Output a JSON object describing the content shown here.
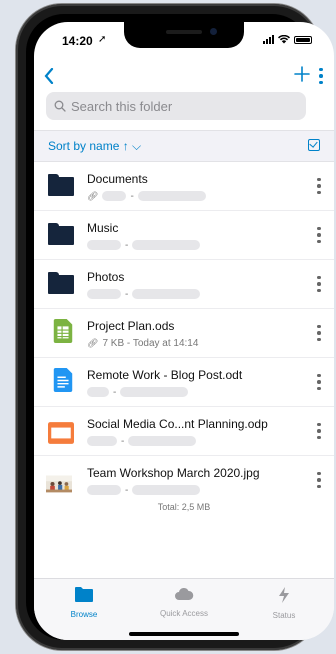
{
  "status_bar": {
    "time": "14:20"
  },
  "search": {
    "placeholder": "Search this folder"
  },
  "sort": {
    "label": "Sort by name ↑ ⌵"
  },
  "files": [
    {
      "name": "Documents",
      "type": "folder",
      "meta": "",
      "shared": true
    },
    {
      "name": "Music",
      "type": "folder",
      "meta": "",
      "shared": false
    },
    {
      "name": "Photos",
      "type": "folder",
      "meta": "",
      "shared": false
    },
    {
      "name": "Project Plan.ods",
      "type": "spreadsheet",
      "meta": "7 KB - Today at 14:14",
      "shared": true
    },
    {
      "name": "Remote Work - Blog Post.odt",
      "type": "document",
      "meta": "",
      "shared": false
    },
    {
      "name": "Social Media Co...nt Planning.odp",
      "type": "presentation",
      "meta": "",
      "shared": false
    },
    {
      "name": "Team Workshop March 2020.jpg",
      "type": "image",
      "meta": "",
      "shared": false
    }
  ],
  "footer": {
    "total": "Total: 2,5 MB"
  },
  "tabs": [
    {
      "label": "Browse",
      "icon": "folder-icon",
      "active": true
    },
    {
      "label": "Quick Access",
      "icon": "cloud-icon",
      "active": false
    },
    {
      "label": "Status",
      "icon": "bolt-icon",
      "active": false
    }
  ],
  "colors": {
    "accent": "#0082c9",
    "folder": "#15253c",
    "ods": "#7cb342",
    "odt": "#2196f3",
    "odp": "#f57c3c"
  }
}
